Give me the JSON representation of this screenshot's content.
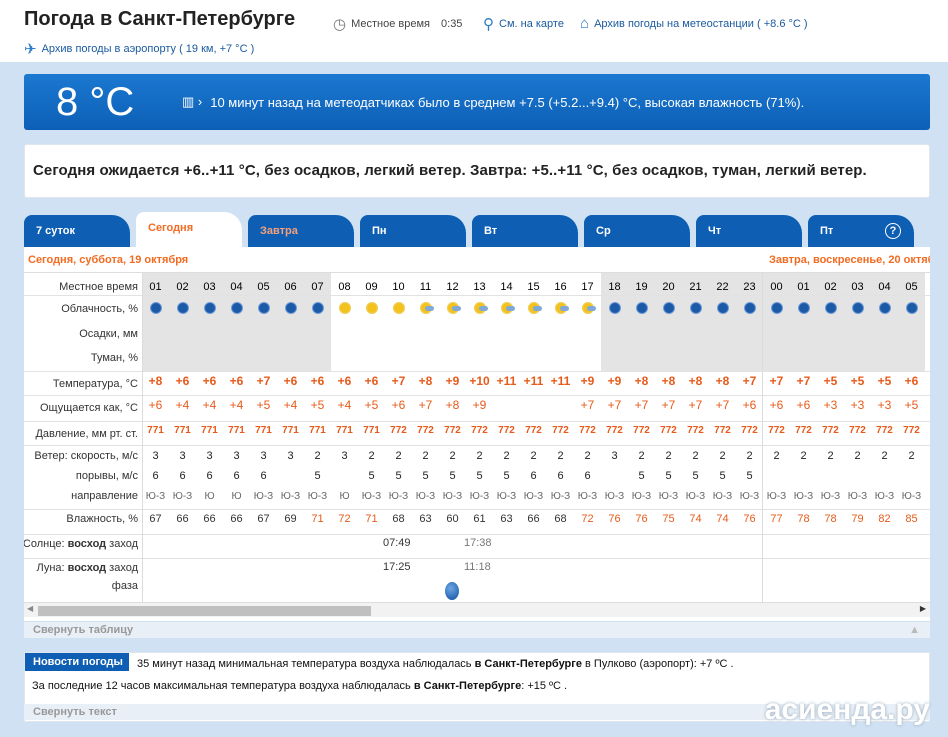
{
  "header": {
    "title": "Погода в Санкт-Петербурге",
    "local_time_label": "Местное время",
    "local_time": "0:35",
    "map_link": "См. на карте",
    "station_archive": "Архив погоды на метеостанции ( +8.6 °C )",
    "airport_archive": "Архив погоды в аэропорту ( 19 км, +7 °C )"
  },
  "now": {
    "temp": "8 °C",
    "text": "10 минут назад на метеодатчиках было в среднем +7.5 (+5.2...+9.4) °С, высокая влажность (71%)."
  },
  "forecast_text": "Сегодня ожидается +6..+11 °C, без осадков, легкий ветер. Завтра: +5..+11 °C, без осадков, туман, легкий ветер.",
  "tabs": [
    "7 суток",
    "Сегодня",
    "Завтра",
    "Пн",
    "Вт",
    "Ср",
    "Чт",
    "Пт"
  ],
  "help": "?",
  "dates": {
    "today": "Сегодня, суббота, 19 октября",
    "tomorrow": "Завтра, воскресенье, 20 октября"
  },
  "labels": {
    "time": "Местное время",
    "cloud": "Облачность, %",
    "precip": "Осадки, мм",
    "fog": "Туман, %",
    "temp": "Температура, °C",
    "feels": "Ощущается как, °C",
    "pressure": "Давление, мм рт. ст.",
    "wind_speed": "Ветер: скорость, м/с",
    "gusts": "порывы, м/с",
    "direction": "направление",
    "humidity": "Влажность, %",
    "sun": "Солнце:",
    "sunrise": "восход",
    "sunset": "заход",
    "moon": "Луна:",
    "moonrise": "восход",
    "moonset": "заход",
    "phase": "фаза"
  },
  "hours": [
    "01",
    "02",
    "03",
    "04",
    "05",
    "06",
    "07",
    "08",
    "09",
    "10",
    "11",
    "12",
    "13",
    "14",
    "15",
    "16",
    "17",
    "18",
    "19",
    "20",
    "21",
    "22",
    "23",
    "00",
    "01",
    "02",
    "03",
    "04",
    "05"
  ],
  "icons": [
    "moon",
    "moon",
    "moon",
    "moon",
    "moon",
    "moon",
    "moon",
    "sun",
    "sun",
    "sun",
    "sun-cloud",
    "sun-cloud",
    "sun-cloud",
    "sun-cloud",
    "sun-cloud",
    "sun-cloud",
    "sun-cloud",
    "moon",
    "moon",
    "moon",
    "moon",
    "moon",
    "moon",
    "moon",
    "moon",
    "moon",
    "moon",
    "moon",
    "moon"
  ],
  "temps": [
    "+8",
    "+6",
    "+6",
    "+6",
    "+7",
    "+6",
    "+6",
    "+6",
    "+6",
    "+7",
    "+8",
    "+9",
    "+10",
    "+11",
    "+11",
    "+11",
    "+9",
    "+9",
    "+8",
    "+8",
    "+8",
    "+8",
    "+7",
    "+7",
    "+7",
    "+5",
    "+5",
    "+5",
    "+6"
  ],
  "feels": [
    "+6",
    "+4",
    "+4",
    "+4",
    "+5",
    "+4",
    "+5",
    "+4",
    "+5",
    "+6",
    "+7",
    "+8",
    "+9",
    "",
    "",
    "",
    "+7",
    "+7",
    "+7",
    "+7",
    "+7",
    "+7",
    "+6",
    "+6",
    "+6",
    "+3",
    "+3",
    "+3",
    "+5"
  ],
  "pressure": [
    "771",
    "771",
    "771",
    "771",
    "771",
    "771",
    "771",
    "771",
    "771",
    "772",
    "772",
    "772",
    "772",
    "772",
    "772",
    "772",
    "772",
    "772",
    "772",
    "772",
    "772",
    "772",
    "772",
    "772",
    "772",
    "772",
    "772",
    "772",
    "772"
  ],
  "wind": [
    "3",
    "3",
    "3",
    "3",
    "3",
    "3",
    "2",
    "3",
    "2",
    "2",
    "2",
    "2",
    "2",
    "2",
    "2",
    "2",
    "2",
    "3",
    "2",
    "2",
    "2",
    "2",
    "2",
    "2",
    "2",
    "2",
    "2",
    "2",
    "2"
  ],
  "gusts": [
    "6",
    "6",
    "6",
    "6",
    "6",
    "",
    "5",
    "",
    "5",
    "5",
    "5",
    "5",
    "5",
    "5",
    "6",
    "6",
    "6",
    "",
    "5",
    "5",
    "5",
    "5",
    "5",
    "",
    "",
    "",
    "",
    "",
    ""
  ],
  "dirs": [
    "Ю-З",
    "Ю-З",
    "Ю",
    "Ю",
    "Ю-З",
    "Ю-З",
    "Ю-З",
    "Ю",
    "Ю-З",
    "Ю-З",
    "Ю-З",
    "Ю-З",
    "Ю-З",
    "Ю-З",
    "Ю-З",
    "Ю-З",
    "Ю-З",
    "Ю-З",
    "Ю-З",
    "Ю-З",
    "Ю-З",
    "Ю-З",
    "Ю-З",
    "Ю-З",
    "Ю-З",
    "Ю-З",
    "Ю-З",
    "Ю-З",
    "Ю-З"
  ],
  "humidity": [
    "67",
    "66",
    "66",
    "66",
    "67",
    "69",
    "71",
    "72",
    "71",
    "68",
    "63",
    "60",
    "61",
    "63",
    "66",
    "68",
    "72",
    "76",
    "76",
    "75",
    "74",
    "74",
    "76",
    "77",
    "78",
    "78",
    "79",
    "82",
    "85"
  ],
  "humidity_high": [
    false,
    false,
    false,
    false,
    false,
    false,
    true,
    true,
    true,
    false,
    false,
    false,
    false,
    false,
    false,
    false,
    true,
    true,
    true,
    true,
    true,
    true,
    true,
    true,
    true,
    true,
    true,
    true,
    true
  ],
  "sun": {
    "rise": "07:49",
    "set": "17:38"
  },
  "moon": {
    "rise": "17:25",
    "set": "11:18"
  },
  "collapse_table": "Свернуть таблицу",
  "news": {
    "button": "Новости погоды",
    "line1_a": "35 минут назад минимальная температура воздуха наблюдалась ",
    "line1_b": "в Санкт-Петербурге",
    "line1_c": " в Пулково (аэропорт): +7 ºС .",
    "line2_a": "За последние 12 часов максимальная температура воздуха наблюдалась ",
    "line2_b": "в Санкт-Петербурге",
    "line2_c": ": +15 ºС ."
  },
  "collapse_text": "Свернуть текст",
  "watermark": "асиенда.ру"
}
